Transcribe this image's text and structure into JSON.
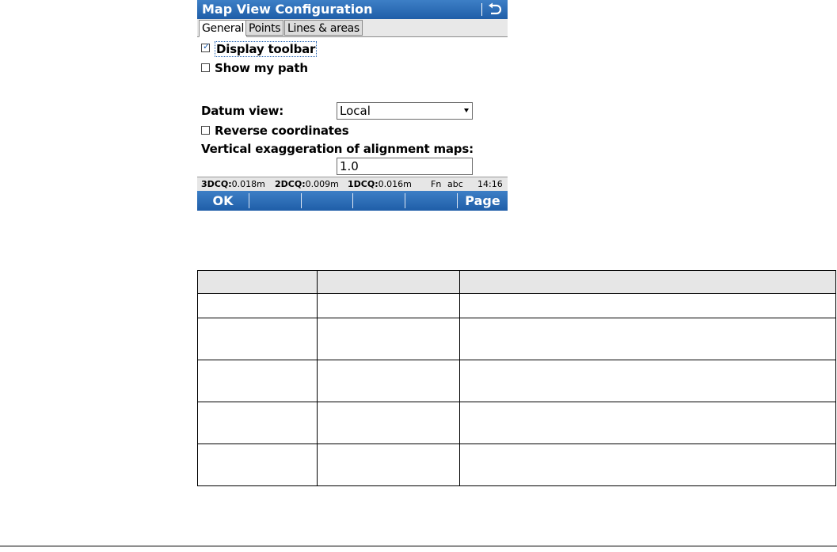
{
  "window": {
    "title": "Map View Configuration",
    "back_icon": "back-arrow-icon"
  },
  "tabs": [
    {
      "label": "General",
      "active": true
    },
    {
      "label": "Points",
      "active": false
    },
    {
      "label": "Lines & areas",
      "active": false
    }
  ],
  "options": {
    "display_toolbar": {
      "label": "Display toolbar",
      "checked": true
    },
    "show_my_path": {
      "label": "Show my path",
      "checked": false
    },
    "reverse_coordinates": {
      "label": "Reverse coordinates",
      "checked": false
    }
  },
  "datum_view": {
    "label": "Datum view:",
    "value": "Local"
  },
  "vertical_exaggeration": {
    "label": "Vertical exaggeration of alignment maps:",
    "value": "1.0"
  },
  "status": {
    "q3_label": "3DCQ:",
    "q3_value": "0.018m",
    "q2_label": "2DCQ:",
    "q2_value": "0.009m",
    "q1_label": "1DCQ:",
    "q1_value": "0.016m",
    "fn": "Fn",
    "abc": "abc",
    "time": "14:16"
  },
  "softkeys": {
    "ok": "OK",
    "page": "Page"
  },
  "colors": {
    "accent": "#1f5ea8",
    "status_bg": "#e6e6e6"
  }
}
